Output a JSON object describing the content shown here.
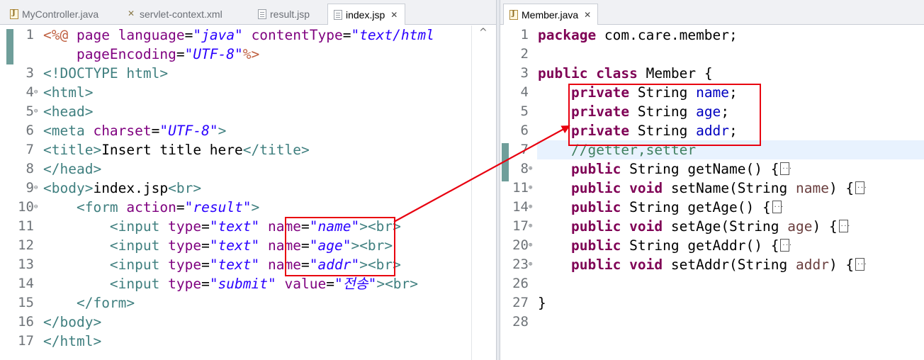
{
  "left_editor": {
    "tabs": [
      {
        "label": "MyController.java",
        "icon": "java-file-icon",
        "active": false
      },
      {
        "label": "servlet-context.xml",
        "icon": "xml-file-icon",
        "active": false
      },
      {
        "label": "result.jsp",
        "icon": "jsp-file-icon",
        "active": false
      },
      {
        "label": "index.jsp",
        "icon": "jsp-file-icon",
        "active": true,
        "close": "✕"
      }
    ],
    "lines": [
      {
        "num": "1",
        "fold": "",
        "tokens": [
          {
            "t": "<%@",
            "c": "jsp"
          },
          {
            "t": " page ",
            "c": "attr"
          },
          {
            "t": "language",
            "c": "attr"
          },
          {
            "t": "=",
            "c": "plain"
          },
          {
            "t": "\"java\"",
            "c": "str"
          },
          {
            "t": " ",
            "c": "plain"
          },
          {
            "t": "contentType",
            "c": "attr"
          },
          {
            "t": "=",
            "c": "plain"
          },
          {
            "t": "\"text/html",
            "c": "str"
          }
        ]
      },
      {
        "num": "",
        "fold": "",
        "tokens": [
          {
            "t": "    pageEncoding",
            "c": "attr"
          },
          {
            "t": "=",
            "c": "plain"
          },
          {
            "t": "\"UTF-8\"",
            "c": "str"
          },
          {
            "t": "%>",
            "c": "jsp"
          }
        ]
      },
      {
        "num": "3",
        "fold": "",
        "tokens": [
          {
            "t": "<!DOCTYPE ",
            "c": "tag"
          },
          {
            "t": "html",
            "c": "tag"
          },
          {
            "t": ">",
            "c": "tag"
          }
        ]
      },
      {
        "num": "4",
        "fold": "⊖",
        "tokens": [
          {
            "t": "<html>",
            "c": "tag"
          }
        ]
      },
      {
        "num": "5",
        "fold": "⊖",
        "tokens": [
          {
            "t": "<head>",
            "c": "tag"
          }
        ]
      },
      {
        "num": "6",
        "fold": "",
        "tokens": [
          {
            "t": "<meta ",
            "c": "tag"
          },
          {
            "t": "charset",
            "c": "attr"
          },
          {
            "t": "=",
            "c": "plain"
          },
          {
            "t": "\"UTF-8\"",
            "c": "str"
          },
          {
            "t": ">",
            "c": "tag"
          }
        ]
      },
      {
        "num": "7",
        "fold": "",
        "tokens": [
          {
            "t": "<title>",
            "c": "tag"
          },
          {
            "t": "Insert title here",
            "c": "plain"
          },
          {
            "t": "</title>",
            "c": "tag"
          }
        ]
      },
      {
        "num": "8",
        "fold": "",
        "tokens": [
          {
            "t": "</head>",
            "c": "tag"
          }
        ]
      },
      {
        "num": "9",
        "fold": "⊖",
        "tokens": [
          {
            "t": "<body>",
            "c": "tag"
          },
          {
            "t": "index.jsp",
            "c": "plain"
          },
          {
            "t": "<br>",
            "c": "tag"
          }
        ]
      },
      {
        "num": "10",
        "fold": "⊖",
        "tokens": [
          {
            "t": "    ",
            "c": "plain"
          },
          {
            "t": "<form ",
            "c": "tag"
          },
          {
            "t": "action",
            "c": "attr"
          },
          {
            "t": "=",
            "c": "plain"
          },
          {
            "t": "\"result\"",
            "c": "str"
          },
          {
            "t": ">",
            "c": "tag"
          }
        ]
      },
      {
        "num": "11",
        "fold": "",
        "tokens": [
          {
            "t": "        ",
            "c": "plain"
          },
          {
            "t": "<input ",
            "c": "tag"
          },
          {
            "t": "type",
            "c": "attr"
          },
          {
            "t": "=",
            "c": "plain"
          },
          {
            "t": "\"text\"",
            "c": "str"
          },
          {
            "t": " ",
            "c": "plain"
          },
          {
            "t": "name",
            "c": "attr"
          },
          {
            "t": "=",
            "c": "plain"
          },
          {
            "t": "\"name\"",
            "c": "str"
          },
          {
            "t": "><br>",
            "c": "tag"
          }
        ]
      },
      {
        "num": "12",
        "fold": "",
        "tokens": [
          {
            "t": "        ",
            "c": "plain"
          },
          {
            "t": "<input ",
            "c": "tag"
          },
          {
            "t": "type",
            "c": "attr"
          },
          {
            "t": "=",
            "c": "plain"
          },
          {
            "t": "\"text\"",
            "c": "str"
          },
          {
            "t": " ",
            "c": "plain"
          },
          {
            "t": "name",
            "c": "attr"
          },
          {
            "t": "=",
            "c": "plain"
          },
          {
            "t": "\"age\"",
            "c": "str"
          },
          {
            "t": "><br>",
            "c": "tag"
          }
        ]
      },
      {
        "num": "13",
        "fold": "",
        "tokens": [
          {
            "t": "        ",
            "c": "plain"
          },
          {
            "t": "<input ",
            "c": "tag"
          },
          {
            "t": "type",
            "c": "attr"
          },
          {
            "t": "=",
            "c": "plain"
          },
          {
            "t": "\"text\"",
            "c": "str"
          },
          {
            "t": " ",
            "c": "plain"
          },
          {
            "t": "name",
            "c": "attr"
          },
          {
            "t": "=",
            "c": "plain"
          },
          {
            "t": "\"addr\"",
            "c": "str"
          },
          {
            "t": "><br>",
            "c": "tag"
          }
        ]
      },
      {
        "num": "14",
        "fold": "",
        "tokens": [
          {
            "t": "        ",
            "c": "plain"
          },
          {
            "t": "<input ",
            "c": "tag"
          },
          {
            "t": "type",
            "c": "attr"
          },
          {
            "t": "=",
            "c": "plain"
          },
          {
            "t": "\"submit\"",
            "c": "str"
          },
          {
            "t": " ",
            "c": "plain"
          },
          {
            "t": "value",
            "c": "attr"
          },
          {
            "t": "=",
            "c": "plain"
          },
          {
            "t": "\"전송\"",
            "c": "str"
          },
          {
            "t": "><br>",
            "c": "tag"
          }
        ]
      },
      {
        "num": "15",
        "fold": "",
        "tokens": [
          {
            "t": "    ",
            "c": "plain"
          },
          {
            "t": "</form>",
            "c": "tag"
          }
        ]
      },
      {
        "num": "16",
        "fold": "",
        "tokens": [
          {
            "t": "</body>",
            "c": "tag"
          }
        ]
      },
      {
        "num": "17",
        "fold": "",
        "tokens": [
          {
            "t": "</html>",
            "c": "tag"
          }
        ]
      }
    ],
    "scroll_up_glyph": "^"
  },
  "right_editor": {
    "tabs": [
      {
        "label": "Member.java",
        "icon": "java-file-icon",
        "active": true,
        "close": "✕"
      }
    ],
    "lines": [
      {
        "num": "1",
        "fold": "",
        "tokens": [
          {
            "t": "package",
            "c": "kw"
          },
          {
            "t": " com.care.member;",
            "c": "plain"
          }
        ]
      },
      {
        "num": "2",
        "fold": "",
        "tokens": []
      },
      {
        "num": "3",
        "fold": "",
        "tokens": [
          {
            "t": "public",
            "c": "kw"
          },
          {
            "t": " ",
            "c": "plain"
          },
          {
            "t": "class",
            "c": "kw"
          },
          {
            "t": " Member {",
            "c": "plain"
          }
        ]
      },
      {
        "num": "4",
        "fold": "",
        "tokens": [
          {
            "t": "    ",
            "c": "plain"
          },
          {
            "t": "private",
            "c": "kw"
          },
          {
            "t": " String ",
            "c": "plain"
          },
          {
            "t": "name",
            "c": "fld"
          },
          {
            "t": ";",
            "c": "plain"
          }
        ]
      },
      {
        "num": "5",
        "fold": "",
        "tokens": [
          {
            "t": "    ",
            "c": "plain"
          },
          {
            "t": "private",
            "c": "kw"
          },
          {
            "t": " String ",
            "c": "plain"
          },
          {
            "t": "age",
            "c": "fld"
          },
          {
            "t": ";",
            "c": "plain"
          }
        ]
      },
      {
        "num": "6",
        "fold": "",
        "tokens": [
          {
            "t": "    ",
            "c": "plain"
          },
          {
            "t": "private",
            "c": "kw"
          },
          {
            "t": " String ",
            "c": "plain"
          },
          {
            "t": "addr",
            "c": "fld"
          },
          {
            "t": ";",
            "c": "plain"
          }
        ]
      },
      {
        "num": "7",
        "fold": "",
        "hl": true,
        "tokens": [
          {
            "t": "    ",
            "c": "plain"
          },
          {
            "t": "//getter,setter",
            "c": "cmt"
          }
        ]
      },
      {
        "num": "8",
        "fold": "⊕",
        "tokens": [
          {
            "t": "    ",
            "c": "plain"
          },
          {
            "t": "public",
            "c": "kw"
          },
          {
            "t": " String getName() {",
            "c": "plain"
          },
          {
            "t": "",
            "c": "box"
          }
        ]
      },
      {
        "num": "11",
        "fold": "⊕",
        "tokens": [
          {
            "t": "    ",
            "c": "plain"
          },
          {
            "t": "public",
            "c": "kw"
          },
          {
            "t": " ",
            "c": "plain"
          },
          {
            "t": "void",
            "c": "kw"
          },
          {
            "t": " setName(String ",
            "c": "plain"
          },
          {
            "t": "name",
            "c": "prm"
          },
          {
            "t": ") {",
            "c": "plain"
          },
          {
            "t": "",
            "c": "box"
          }
        ]
      },
      {
        "num": "14",
        "fold": "⊕",
        "tokens": [
          {
            "t": "    ",
            "c": "plain"
          },
          {
            "t": "public",
            "c": "kw"
          },
          {
            "t": " String getAge() {",
            "c": "plain"
          },
          {
            "t": "",
            "c": "box"
          }
        ]
      },
      {
        "num": "17",
        "fold": "⊕",
        "tokens": [
          {
            "t": "    ",
            "c": "plain"
          },
          {
            "t": "public",
            "c": "kw"
          },
          {
            "t": " ",
            "c": "plain"
          },
          {
            "t": "void",
            "c": "kw"
          },
          {
            "t": " setAge(String ",
            "c": "plain"
          },
          {
            "t": "age",
            "c": "prm"
          },
          {
            "t": ") {",
            "c": "plain"
          },
          {
            "t": "",
            "c": "box"
          }
        ]
      },
      {
        "num": "20",
        "fold": "⊕",
        "tokens": [
          {
            "t": "    ",
            "c": "plain"
          },
          {
            "t": "public",
            "c": "kw"
          },
          {
            "t": " String getAddr() {",
            "c": "plain"
          },
          {
            "t": "",
            "c": "box"
          }
        ]
      },
      {
        "num": "23",
        "fold": "⊕",
        "tokens": [
          {
            "t": "    ",
            "c": "plain"
          },
          {
            "t": "public",
            "c": "kw"
          },
          {
            "t": " ",
            "c": "plain"
          },
          {
            "t": "void",
            "c": "kw"
          },
          {
            "t": " setAddr(String ",
            "c": "plain"
          },
          {
            "t": "addr",
            "c": "prm"
          },
          {
            "t": ") {",
            "c": "plain"
          },
          {
            "t": "",
            "c": "box"
          }
        ]
      },
      {
        "num": "26",
        "fold": "",
        "tokens": []
      },
      {
        "num": "27",
        "fold": "",
        "tokens": [
          {
            "t": "}",
            "c": "plain"
          }
        ]
      },
      {
        "num": "28",
        "fold": "",
        "tokens": []
      }
    ]
  },
  "colors": {
    "annotation": "#e8000f",
    "keyword": "#7f0055",
    "tag": "#3f7f7f",
    "attribute": "#7f007f",
    "string": "#2a00ff",
    "comment": "#3f7f5f",
    "field": "#0000c0"
  }
}
